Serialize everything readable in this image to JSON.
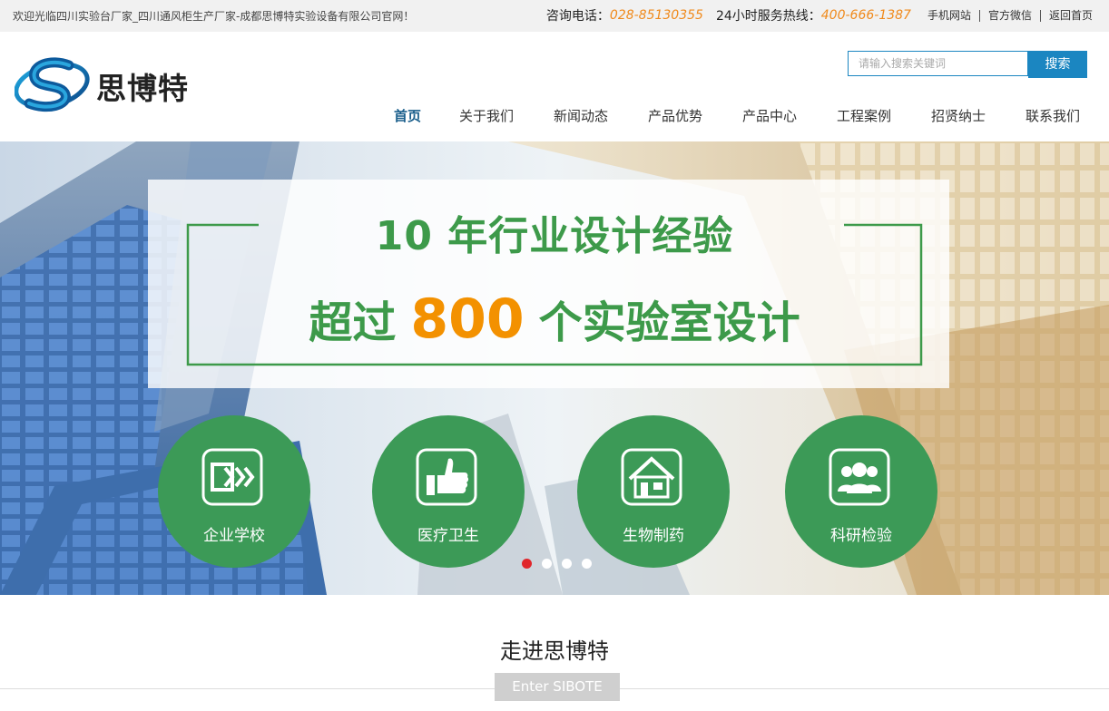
{
  "topbar": {
    "welcome": "欢迎光临四川实验台厂家_四川通风柜生产厂家-成都思博特实验设备有限公司官网！",
    "consult_label": "咨询电话：",
    "consult_phone": "028-85130355",
    "hotline_label": "24小时服务热线：",
    "hotline_phone": "400-666-1387",
    "links": [
      "手机网站",
      "官方微信",
      "返回首页"
    ]
  },
  "header": {
    "logo_text": "思博特",
    "search": {
      "placeholder": "请输入搜索关键词",
      "button": "搜索"
    },
    "nav": [
      "首页",
      "关于我们",
      "新闻动态",
      "产品优势",
      "产品中心",
      "工程案例",
      "招贤纳士",
      "联系我们"
    ]
  },
  "banner": {
    "line1": "10 年行业设计经验",
    "line2_pre": "超过",
    "line2_num": "800",
    "line2_post": "个实验室设计",
    "categories": [
      {
        "label": "企业学校",
        "icon": "arrow-forward-icon"
      },
      {
        "label": "医疗卫生",
        "icon": "thumbs-up-icon"
      },
      {
        "label": "生物制药",
        "icon": "house-icon"
      },
      {
        "label": "科研检验",
        "icon": "people-group-icon"
      }
    ]
  },
  "intro": {
    "title": "走进思博特",
    "subtitle": "Enter SIBOTE"
  },
  "colors": {
    "brand_green": "#3c9a57",
    "accent_orange": "#f39100",
    "link_blue": "#1b86c1",
    "active_dot": "#e0262b"
  }
}
